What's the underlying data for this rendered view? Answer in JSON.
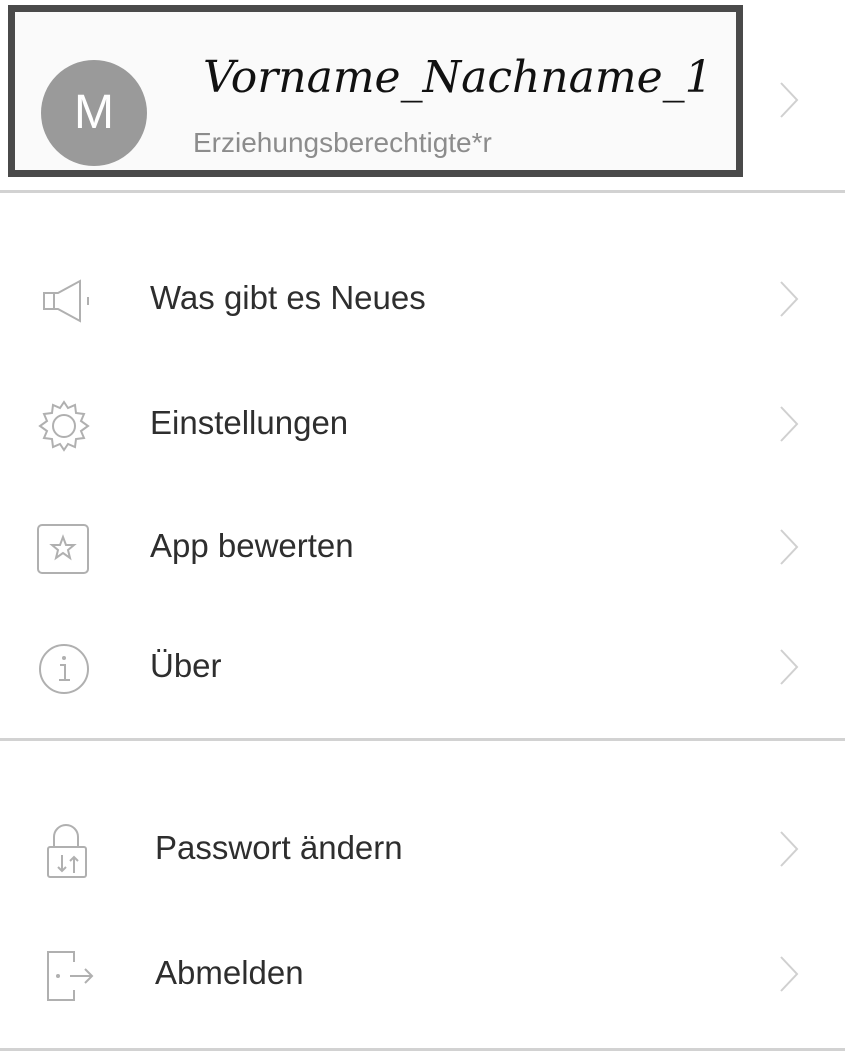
{
  "profile": {
    "avatar_letter": "M",
    "name": "Vorname_Nachname_1",
    "role": "Erziehungsberechtigte*r"
  },
  "menu": {
    "group1": [
      {
        "label": "Was gibt es Neues",
        "icon": "megaphone-icon"
      },
      {
        "label": "Einstellungen",
        "icon": "gear-icon"
      },
      {
        "label": "App bewerten",
        "icon": "star-icon"
      },
      {
        "label": "Über",
        "icon": "info-icon"
      }
    ],
    "group2": [
      {
        "label": "Passwort ändern",
        "icon": "lock-icon"
      },
      {
        "label": "Abmelden",
        "icon": "logout-icon"
      }
    ]
  },
  "colors": {
    "frame": "#4a4a4a",
    "avatar": "#9a9a9a",
    "divider": "#d2d2d2",
    "chevron": "#d0d0d0"
  }
}
